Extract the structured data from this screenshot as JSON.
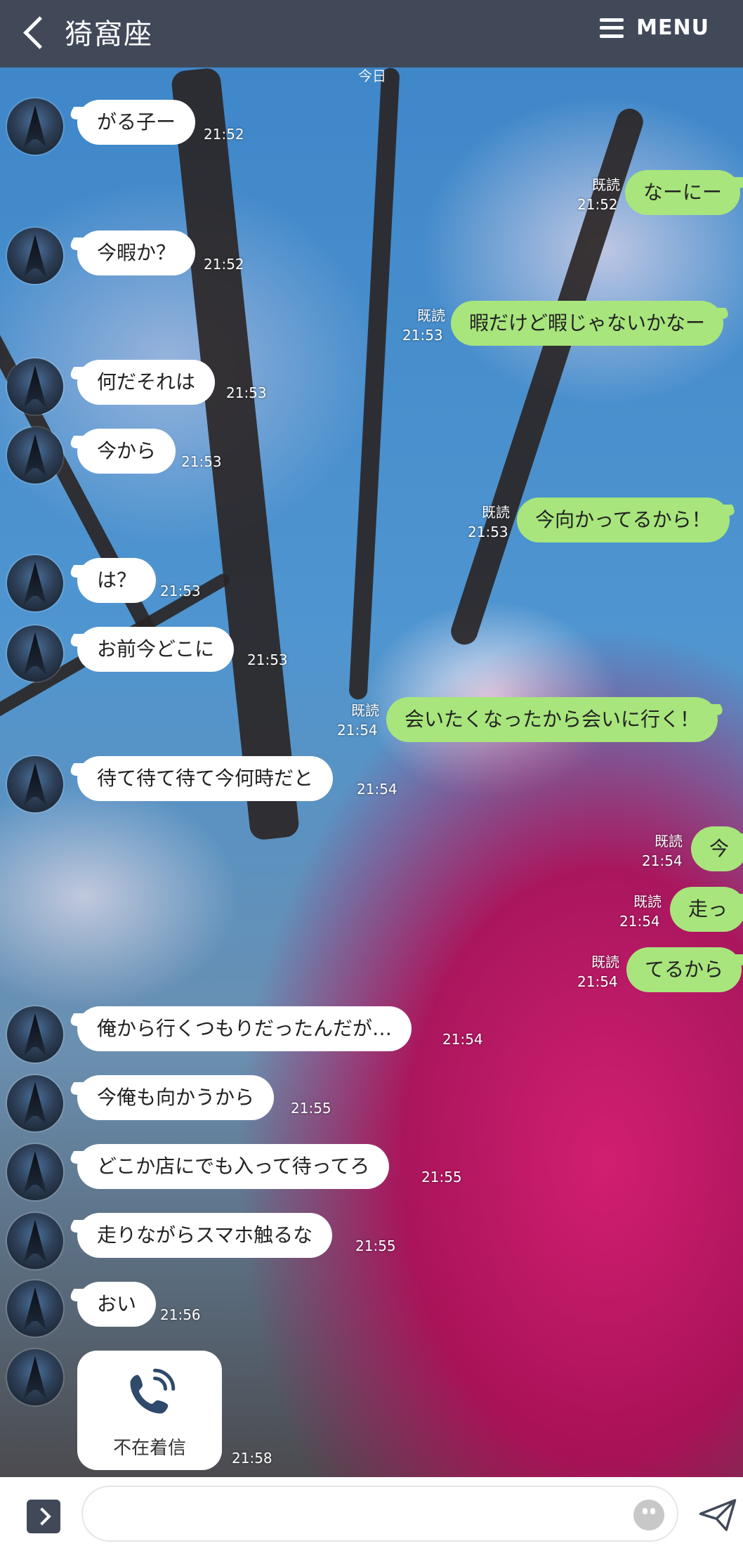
{
  "header": {
    "title": "猗窩座",
    "menu_label": "MENU",
    "date_partial": "今日"
  },
  "messages": [
    {
      "type": "in",
      "text": "がる子ー",
      "time": "21:52"
    },
    {
      "type": "out",
      "text": "なーにー",
      "time": "21:52",
      "status": "既読"
    },
    {
      "type": "in",
      "text": "今暇か？",
      "time": "21:52"
    },
    {
      "type": "out",
      "text": "暇だけど暇じゃないかなー",
      "time": "21:53",
      "status": "既読"
    },
    {
      "type": "in",
      "text": "何だそれは",
      "time": "21:53"
    },
    {
      "type": "in",
      "text": "今から",
      "time": "21:53"
    },
    {
      "type": "out",
      "text": "今向かってるから！",
      "time": "21:53",
      "status": "既読"
    },
    {
      "type": "in",
      "text": "は？",
      "time": "21:53"
    },
    {
      "type": "in",
      "text": "お前今どこに",
      "time": "21:53"
    },
    {
      "type": "out",
      "text": "会いたくなったから会いに行く！",
      "time": "21:54",
      "status": "既読"
    },
    {
      "type": "in",
      "text": "待て待て待て今何時だと",
      "time": "21:54"
    },
    {
      "type": "out",
      "text": "今",
      "time": "21:54",
      "status": "既読"
    },
    {
      "type": "out",
      "text": "走っ",
      "time": "21:54",
      "status": "既読"
    },
    {
      "type": "out",
      "text": "てるから",
      "time": "21:54",
      "status": "既読"
    },
    {
      "type": "in",
      "text": "俺から行くつもりだったんだが…",
      "time": "21:54"
    },
    {
      "type": "in",
      "text": "今俺も向かうから",
      "time": "21:55"
    },
    {
      "type": "in",
      "text": "どこか店にでも入って待ってろ",
      "time": "21:55"
    },
    {
      "type": "in",
      "text": "走りながらスマホ触るな",
      "time": "21:55"
    },
    {
      "type": "in",
      "text": "おい",
      "time": "21:56"
    },
    {
      "type": "call",
      "text": "不在着信",
      "time": "21:58"
    }
  ],
  "input": {
    "placeholder": ""
  },
  "colors": {
    "header": "#414959",
    "outgoing": "#a8e57c",
    "incoming": "#ffffff"
  },
  "icons": [
    "back-icon",
    "menu-icon",
    "expand-icon",
    "emoji-icon",
    "send-icon",
    "phone-icon"
  ]
}
